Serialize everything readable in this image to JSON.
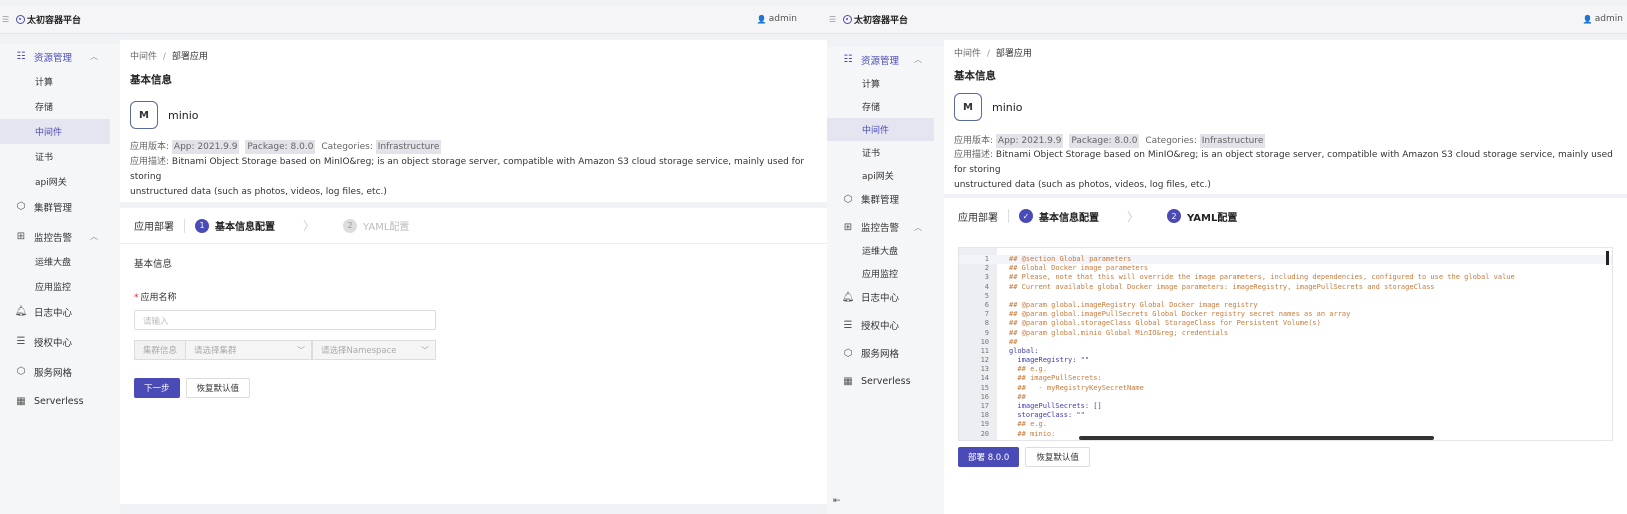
{
  "header": {
    "brand": "太初容器平台",
    "user": "admin"
  },
  "sidebar": {
    "resource": "资源管理",
    "compute": "计算",
    "storage": "存储",
    "middleware": "中间件",
    "cert": "证书",
    "gateway": "api网关",
    "cluster": "集群管理",
    "monitor": "监控告警",
    "ops_dashboard": "运维大盘",
    "app_monitor": "应用监控",
    "log": "日志中心",
    "auth": "授权中心",
    "mesh": "服务网格",
    "serverless": "Serverless"
  },
  "breadcrumb": {
    "parent": "中间件",
    "separator": "/",
    "current": "部署应用"
  },
  "app": {
    "section_title": "基本信息",
    "icon_letter": "M",
    "name": "minio",
    "version_label": "应用版本:",
    "app_version": "App: 2021.9.9",
    "package_version": "Package: 8.0.0",
    "categories_label": "Categories:",
    "category": "Infrastructure",
    "desc_label": "应用描述:",
    "desc_line1": "Bitnami Object Storage based on MinIO&reg; is an object storage server, compatible with Amazon S3 cloud storage service, mainly used for storing",
    "desc_line2": "unstructured data (such as photos, videos, log files, etc.)"
  },
  "steps": {
    "title": "应用部署",
    "step1_num": "1",
    "step1_label": "基本信息配置",
    "step2_num": "2",
    "step2_label": "YAML配置",
    "done_mark": "✓"
  },
  "form": {
    "heading": "基本信息",
    "name_label": "应用名称",
    "name_placeholder": "请输入",
    "cluster_label": "集群信息",
    "cluster_placeholder": "请选择集群",
    "ns_placeholder": "请选择Namespace",
    "next_button": "下一步",
    "reset_button": "恢复默认值"
  },
  "yaml": {
    "lines": [
      {
        "n": "1",
        "t": "## @section Global parameters",
        "c": "comment"
      },
      {
        "n": "2",
        "t": "## Global Docker image parameters",
        "c": "comment"
      },
      {
        "n": "3",
        "t": "## Please, note that this will override the image parameters, including dependencies, configured to use the global value",
        "c": "comment"
      },
      {
        "n": "4",
        "t": "## Current available global Docker image parameters: imageRegistry, imagePullSecrets and storageClass",
        "c": "comment"
      },
      {
        "n": "5",
        "t": "",
        "c": "comment"
      },
      {
        "n": "6",
        "t": "## @param global.imageRegistry Global Docker image registry",
        "c": "comment"
      },
      {
        "n": "7",
        "t": "## @param global.imagePullSecrets Global Docker registry secret names as an array",
        "c": "comment"
      },
      {
        "n": "8",
        "t": "## @param global.storageClass Global StorageClass for Persistent Volume(s)",
        "c": "comment"
      },
      {
        "n": "9",
        "t": "## @param global.minio Global MinIO&reg; credentials",
        "c": "comment"
      },
      {
        "n": "10",
        "t": "##",
        "c": "comment"
      },
      {
        "n": "11",
        "t": "global:",
        "c": "key"
      },
      {
        "n": "12",
        "t": "  imageRegistry: \"\"",
        "c": "key"
      },
      {
        "n": "13",
        "t": "  ## e.g.",
        "c": "comment"
      },
      {
        "n": "14",
        "t": "  ## imagePullSecrets:",
        "c": "comment"
      },
      {
        "n": "15",
        "t": "  ##   - myRegistryKeySecretName",
        "c": "comment"
      },
      {
        "n": "16",
        "t": "  ##",
        "c": "comment"
      },
      {
        "n": "17",
        "t": "  imagePullSecrets: []",
        "c": "key"
      },
      {
        "n": "18",
        "t": "  storageClass: \"\"",
        "c": "key"
      },
      {
        "n": "19",
        "t": "  ## e.g.",
        "c": "comment"
      },
      {
        "n": "20",
        "t": "  ## minio:",
        "c": "comment"
      }
    ],
    "deploy_button": "部署 8.0.0",
    "reset_button": "恢复默认值"
  },
  "colors": {
    "primary": "#4b4bb7",
    "comment": "#c87a3a",
    "key": "#3b3bb0"
  }
}
